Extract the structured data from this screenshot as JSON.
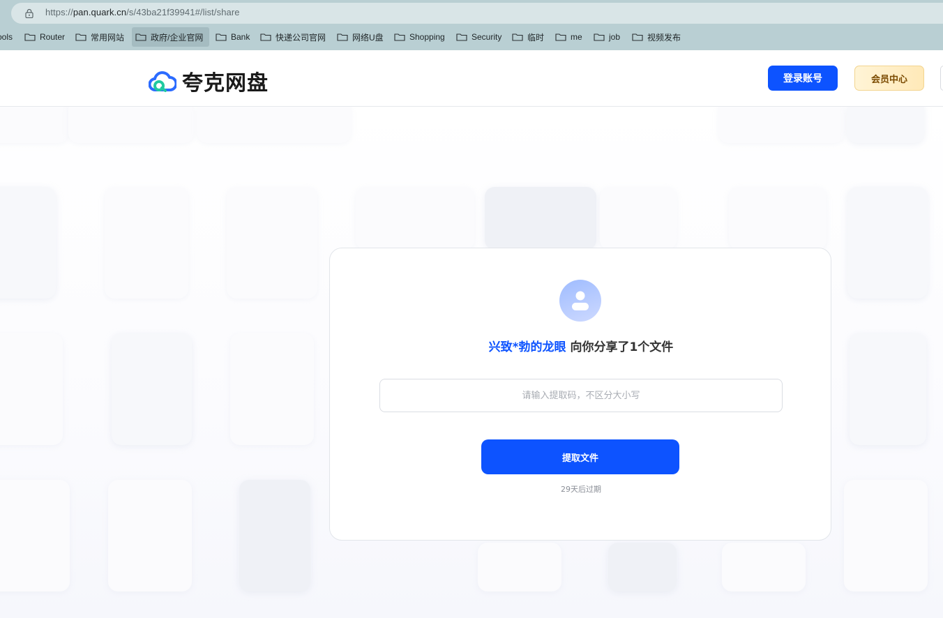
{
  "browser": {
    "url_prefix": "https://",
    "url_host": "pan.quark.cn",
    "url_path": "/s/43ba21f39941#/list/share",
    "bookmarks": [
      {
        "label": "ools"
      },
      {
        "label": "Router"
      },
      {
        "label": "常用网站"
      },
      {
        "label": "政府/企业官网"
      },
      {
        "label": "Bank"
      },
      {
        "label": "快递公司官网"
      },
      {
        "label": "网络U盘"
      },
      {
        "label": "Shopping"
      },
      {
        "label": "Security"
      },
      {
        "label": "临时"
      },
      {
        "label": "me"
      },
      {
        "label": "job"
      },
      {
        "label": "视频发布"
      }
    ]
  },
  "header": {
    "logo_text": "夸克网盘",
    "login_label": "登录账号",
    "vip_label": "会员中心"
  },
  "share": {
    "sharer": "兴致*勃的龙眼",
    "message": " 向你分享了1个文件",
    "code_placeholder": "请输入提取码，不区分大小写",
    "code_value": "",
    "extract_label": "提取文件",
    "expire_text": "29天后过期"
  },
  "colors": {
    "primary": "#0d53ff",
    "vip_bg": "#ffe9b8",
    "vip_text": "#7a4a00"
  },
  "icons": [
    "lock-icon",
    "folder-icon",
    "quark-cloud-logo-icon",
    "user-icon"
  ]
}
